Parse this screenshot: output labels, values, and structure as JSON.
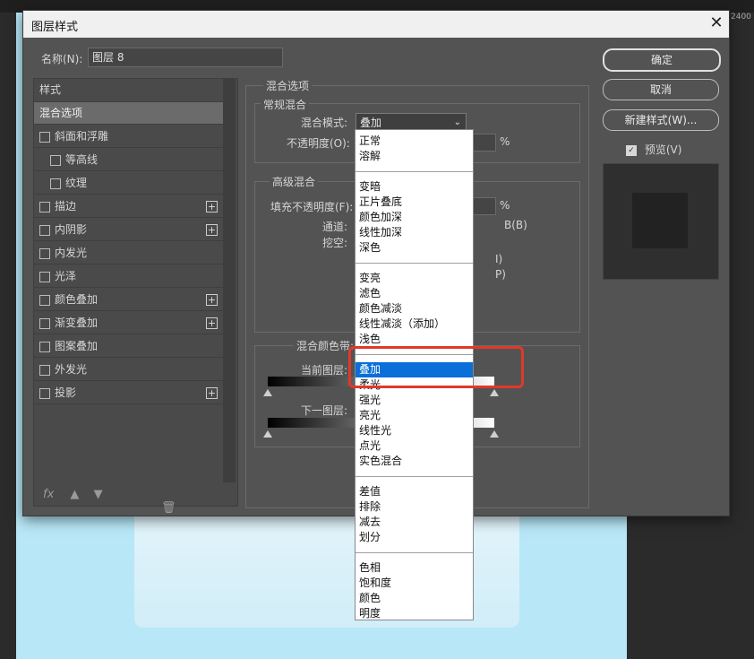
{
  "ruler": {
    "right_number": "2400"
  },
  "dialog": {
    "title": "图层样式",
    "close_glyph": "✕",
    "name_label": "名称(N):",
    "name_value": "图层 8"
  },
  "left_list": {
    "header": "样式",
    "items": [
      {
        "label": "混合选项",
        "checkbox": false,
        "plus": false,
        "selected": true,
        "indent": 0
      },
      {
        "label": "斜面和浮雕",
        "checkbox": true,
        "plus": false,
        "indent": 0
      },
      {
        "label": "等高线",
        "checkbox": true,
        "plus": false,
        "indent": 1
      },
      {
        "label": "纹理",
        "checkbox": true,
        "plus": false,
        "indent": 1
      },
      {
        "label": "描边",
        "checkbox": true,
        "plus": true,
        "indent": 0
      },
      {
        "label": "内阴影",
        "checkbox": true,
        "plus": true,
        "indent": 0
      },
      {
        "label": "内发光",
        "checkbox": true,
        "plus": false,
        "indent": 0
      },
      {
        "label": "光泽",
        "checkbox": true,
        "plus": false,
        "indent": 0
      },
      {
        "label": "颜色叠加",
        "checkbox": true,
        "plus": true,
        "indent": 0
      },
      {
        "label": "渐变叠加",
        "checkbox": true,
        "plus": true,
        "indent": 0
      },
      {
        "label": "图案叠加",
        "checkbox": true,
        "plus": false,
        "indent": 0
      },
      {
        "label": "外发光",
        "checkbox": true,
        "plus": false,
        "indent": 0
      },
      {
        "label": "投影",
        "checkbox": true,
        "plus": true,
        "indent": 0
      }
    ],
    "fx_label": "fx"
  },
  "blend": {
    "section_title": "混合选项",
    "general_title": "常规混合",
    "mode_label": "混合模式:",
    "mode_value": "叠加",
    "opacity_label": "不透明度(O):",
    "opacity_unit": "%",
    "advanced_title": "高级混合",
    "fill_label": "填充不透明度(F):",
    "fill_unit": "%",
    "channels_label": "通道:",
    "channel_b": "B(B)",
    "knockout_label": "挖空:",
    "frag_i": "I)",
    "frag_p": "P)",
    "blendif_label": "混合颜色带:",
    "this_layer_label": "当前图层:",
    "underlying_label": "下一图层:"
  },
  "buttons": {
    "ok": "确定",
    "cancel": "取消",
    "new_style": "新建样式(W)...",
    "preview_label": "预览(V)"
  },
  "menu": {
    "groups": [
      [
        "正常",
        "溶解"
      ],
      [
        "变暗",
        "正片叠底",
        "颜色加深",
        "线性加深",
        "深色"
      ],
      [
        "变亮",
        "滤色",
        "颜色减淡",
        "线性减淡（添加）",
        "浅色"
      ],
      [
        "叠加",
        "柔光",
        "强光",
        "亮光",
        "线性光",
        "点光",
        "实色混合"
      ],
      [
        "差值",
        "排除",
        "减去",
        "划分"
      ],
      [
        "色相",
        "饱和度",
        "颜色",
        "明度"
      ]
    ],
    "highlighted": "叠加"
  },
  "colors": {
    "highlight": "#0a6fd8",
    "annotation": "#e0392b",
    "canvas": "#b8e7f7"
  }
}
